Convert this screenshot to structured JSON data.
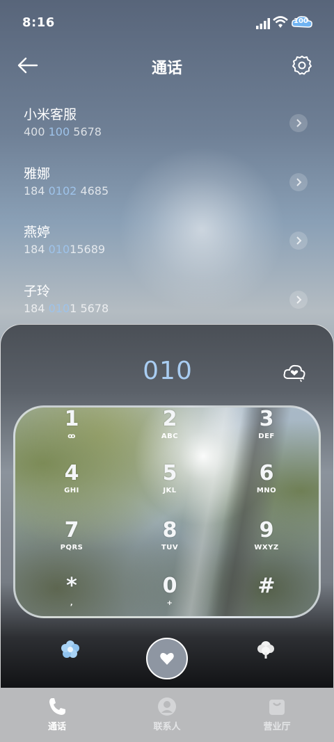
{
  "status_bar": {
    "time": "8:16",
    "battery": "100"
  },
  "header": {
    "title": "通话"
  },
  "contacts": [
    {
      "name": "小米客服",
      "number_pre": "400 ",
      "number_hl": "100",
      "number_post": " 5678"
    },
    {
      "name": "雅娜",
      "number_pre": "184 ",
      "number_hl": "0102",
      "number_post": " 4685"
    },
    {
      "name": "燕婷",
      "number_pre": "184 ",
      "number_hl": "010",
      "number_post": "15689"
    },
    {
      "name": "子玲",
      "number_pre": "184 ",
      "number_hl": "010",
      "number_post": "1 5678"
    }
  ],
  "dialer": {
    "input": "010",
    "keys": [
      {
        "digit": "1",
        "letters": "ꝏ"
      },
      {
        "digit": "2",
        "letters": "ABC"
      },
      {
        "digit": "3",
        "letters": "DEF"
      },
      {
        "digit": "4",
        "letters": "GHI"
      },
      {
        "digit": "5",
        "letters": "JKL"
      },
      {
        "digit": "6",
        "letters": "MNO"
      },
      {
        "digit": "7",
        "letters": "PQRS"
      },
      {
        "digit": "8",
        "letters": "TUV"
      },
      {
        "digit": "9",
        "letters": "WXYZ"
      },
      {
        "digit": "*",
        "letters": ","
      },
      {
        "digit": "0",
        "letters": "+"
      },
      {
        "digit": "#",
        "letters": ""
      }
    ]
  },
  "tabs": [
    {
      "label": "通话",
      "icon": "phone-icon",
      "active": true
    },
    {
      "label": "联系人",
      "icon": "person-icon",
      "active": false
    },
    {
      "label": "营业厅",
      "icon": "bag-icon",
      "active": false
    }
  ],
  "colors": {
    "accent": "#a9cdf2",
    "number_highlight": "#9ec3ea",
    "tab_bar": "#b9babc"
  }
}
